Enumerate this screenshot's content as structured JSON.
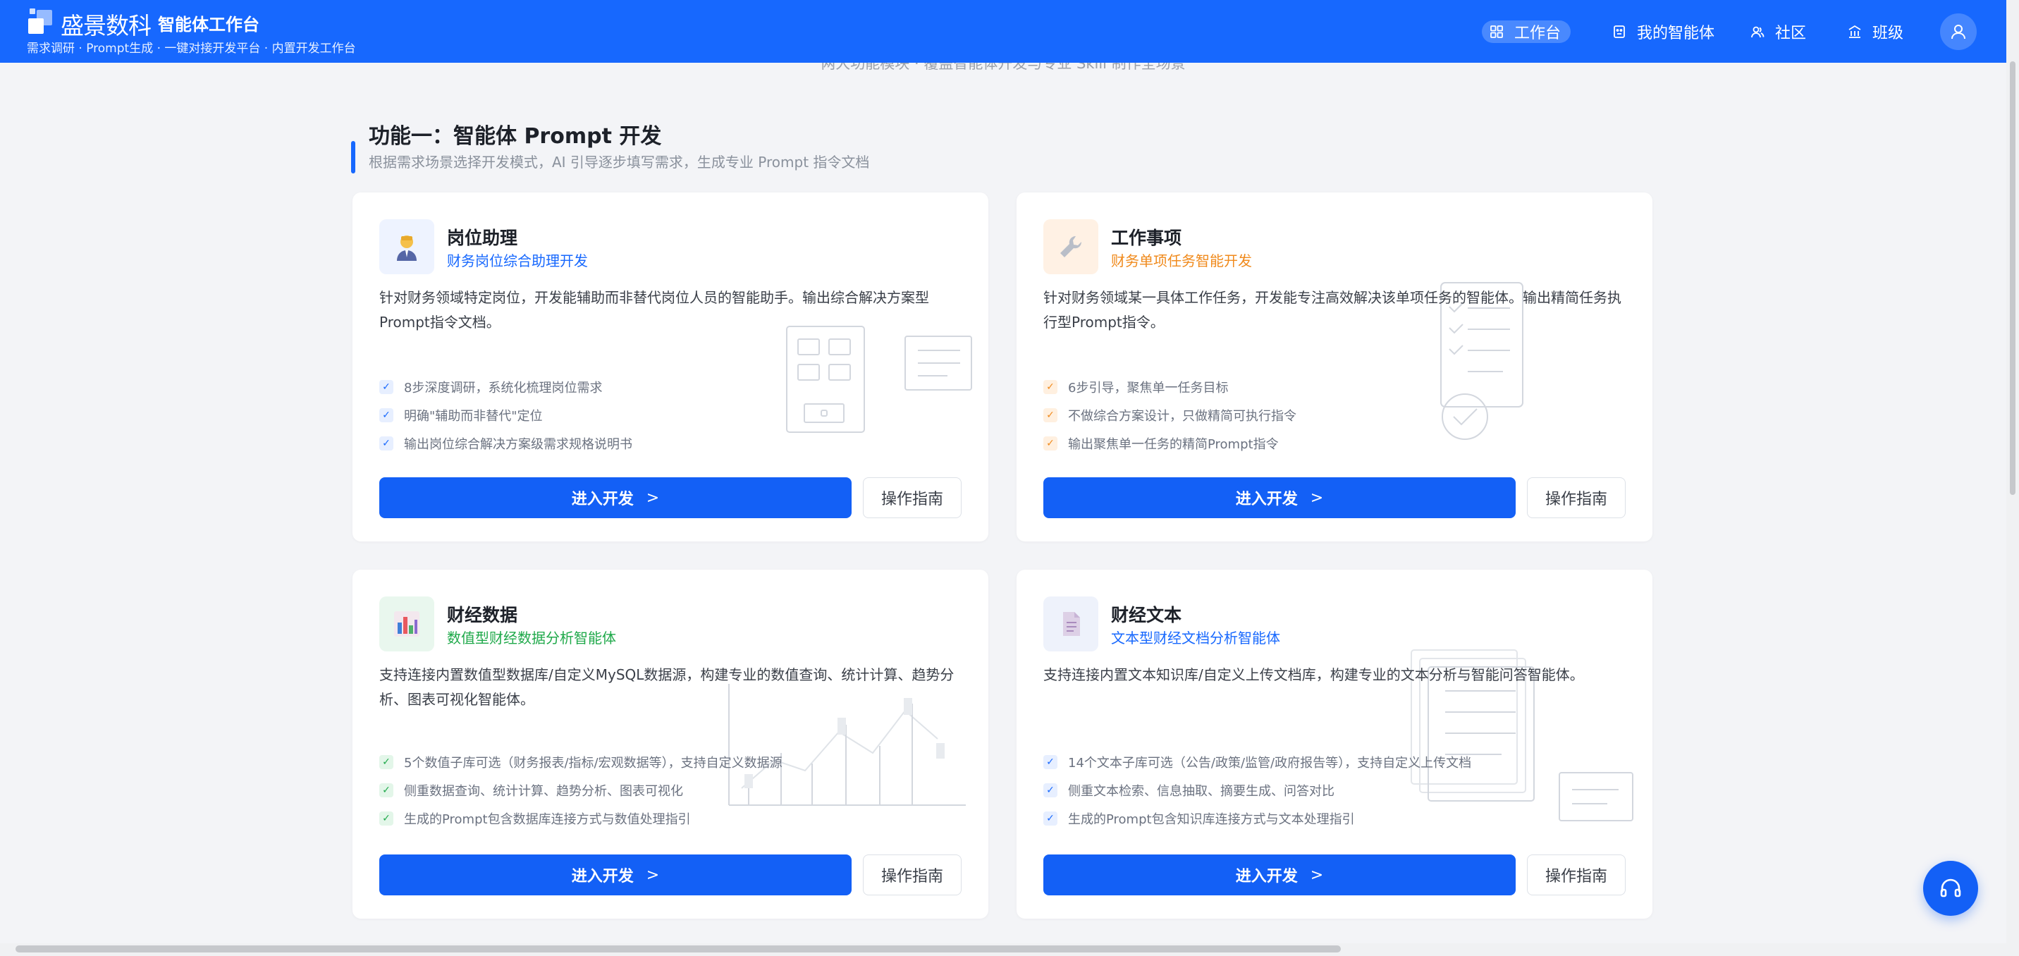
{
  "header": {
    "logo_text": "盛景数科",
    "app_title": "智能体工作台",
    "tagline": "需求调研 · Prompt生成 · 一键对接开发平台 · 内置开发工作台",
    "nav": [
      {
        "label": "工作台",
        "icon": "grid-icon",
        "active": true
      },
      {
        "label": "我的智能体",
        "icon": "robot-icon",
        "active": false
      },
      {
        "label": "社区",
        "icon": "people-icon",
        "active": false
      },
      {
        "label": "班级",
        "icon": "building-icon",
        "active": false
      }
    ],
    "avatar_icon": "user-icon"
  },
  "page": {
    "subtitle": "两大功能模块 · 覆盖智能体开发与专业 Skill 制作全场景"
  },
  "section": {
    "title": "功能一：智能体 Prompt 开发",
    "desc": "根据需求场景选择开发模式，AI 引导逐步填写需求，生成专业 Prompt 指令文档"
  },
  "cards": [
    {
      "title": "岗位助理",
      "subtitle": "财务岗位综合助理开发",
      "accent": "#1768fe",
      "icon": "person-icon",
      "desc": "针对财务领域特定岗位，开发能辅助而非替代岗位人员的智能助手。输出综合解决方案型Prompt指令文档。",
      "features": [
        "8步深度调研，系统化梳理岗位需求",
        "明确\"辅助而非替代\"定位",
        "输出岗位综合解决方案级需求规格说明书"
      ],
      "primary_label": "进入开发",
      "secondary_label": "操作指南"
    },
    {
      "title": "工作事项",
      "subtitle": "财务单项任务智能开发",
      "accent": "#f08a1c",
      "icon": "wrench-icon",
      "desc": "针对财务领域某一具体工作任务，开发能专注高效解决该单项任务的智能体。输出精简任务执行型Prompt指令。",
      "features": [
        "6步引导，聚焦单一任务目标",
        "不做综合方案设计，只做精简可执行指令",
        "输出聚焦单一任务的精简Prompt指令"
      ],
      "primary_label": "进入开发",
      "secondary_label": "操作指南"
    },
    {
      "title": "财经数据",
      "subtitle": "数值型财经数据分析智能体",
      "accent": "#1fa94a",
      "icon": "bar-chart-icon",
      "desc": "支持连接内置数值型数据库/自定义MySQL数据源，构建专业的数值查询、统计计算、趋势分析、图表可视化智能体。",
      "features": [
        "5个数值子库可选（财务报表/指标/宏观数据等），支持自定义数据源",
        "侧重数据查询、统计计算、趋势分析、图表可视化",
        "生成的Prompt包含数据库连接方式与数值处理指引"
      ],
      "primary_label": "进入开发",
      "secondary_label": "操作指南"
    },
    {
      "title": "财经文本",
      "subtitle": "文本型财经文档分析智能体",
      "accent": "#1768fe",
      "icon": "document-icon",
      "desc": "支持连接内置文本知识库/自定义上传文档库，构建专业的文本分析与智能问答智能体。",
      "features": [
        "14个文本子库可选（公告/政策/监管/政府报告等），支持自定义上传文档",
        "侧重文本检索、信息抽取、摘要生成、问答对比",
        "生成的Prompt包含知识库连接方式与文本处理指引"
      ],
      "primary_label": "进入开发",
      "secondary_label": "操作指南"
    }
  ],
  "support_icon": "headset-icon"
}
